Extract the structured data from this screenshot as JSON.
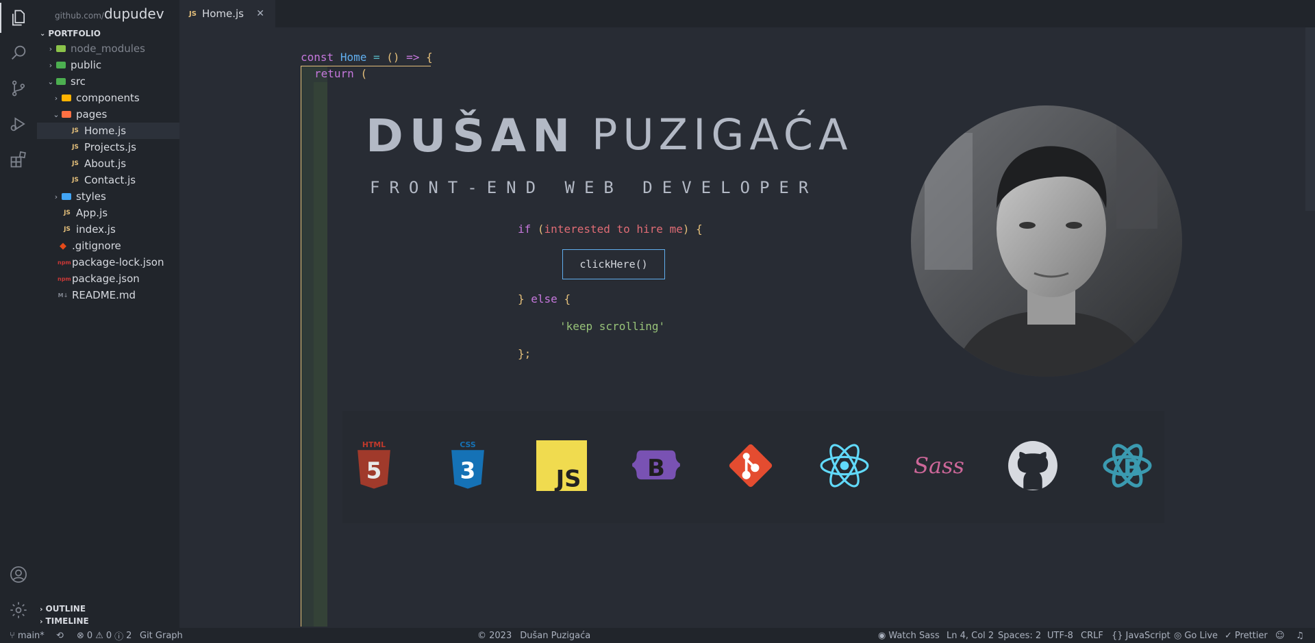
{
  "brand": {
    "prefix": "github.com/",
    "name": "dupudev"
  },
  "explorer": {
    "project": "PORTFOLIO",
    "items": [
      {
        "label": "node_modules"
      },
      {
        "label": "public"
      },
      {
        "label": "src"
      },
      {
        "label": "components"
      },
      {
        "label": "pages"
      },
      {
        "label": "Home.js"
      },
      {
        "label": "Projects.js"
      },
      {
        "label": "About.js"
      },
      {
        "label": "Contact.js"
      },
      {
        "label": "styles"
      },
      {
        "label": "App.js"
      },
      {
        "label": "index.js"
      },
      {
        "label": ".gitignore"
      },
      {
        "label": "package-lock.json"
      },
      {
        "label": "package.json"
      },
      {
        "label": "README.md"
      }
    ],
    "outline": "OUTLINE",
    "timeline": "TIMELINE"
  },
  "tab": {
    "label": "Home.js",
    "badge": "JS"
  },
  "code": {
    "l1_const": "const",
    "l1_name": "Home",
    "l1_eq": "=",
    "l1_parens": "()",
    "l1_arrow": "=>",
    "l1_brace": "{",
    "l2_return": "return",
    "l2_paren": "(",
    "if_kw": "if",
    "if_open": "(",
    "if_cond": "interested to hire me",
    "if_close": ")",
    "if_brace": "{",
    "button": "clickHere()",
    "else_close": "}",
    "else_kw": "else",
    "else_open": "{",
    "else_str": "'keep scrolling'",
    "end": "};"
  },
  "hero": {
    "first_name": "DUŠAN",
    "last_name": "PUZIGAĆA",
    "subtitle": "FRONT-END WEB DEVELOPER"
  },
  "tech_icons": [
    "html5-icon",
    "css3-icon",
    "javascript-icon",
    "bootstrap-icon",
    "git-icon",
    "react-icon",
    "sass-icon",
    "github-icon",
    "redux-icon"
  ],
  "tech_labels": {
    "html": "HTML",
    "css": "CSS",
    "js": "JS",
    "sass": "Sass"
  },
  "statusbar": {
    "branch": "main*",
    "errors": "0",
    "warnings": "0",
    "infos": "2",
    "git_graph": "Git Graph",
    "copyright": "© 2023",
    "author": "Dušan Puzigaća",
    "watch_sass": "Watch Sass",
    "position": "Ln 4, Col 2",
    "spaces": "Spaces: 2",
    "encoding": "UTF-8",
    "eol": "CRLF",
    "language_braces": "{}",
    "language": "JavaScript",
    "go_live": "Go Live",
    "prettier": "Prettier"
  },
  "colors": {
    "editor_bg": "#282c34",
    "sidebar_bg": "#21252b",
    "keyword": "#c678dd",
    "function": "#61afef",
    "string": "#98c379",
    "variable": "#e06c75",
    "bracket": "#e5c07b"
  }
}
